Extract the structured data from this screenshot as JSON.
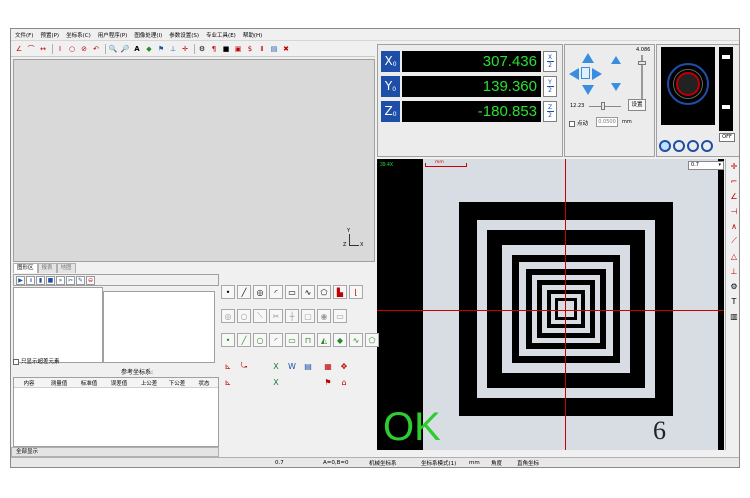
{
  "menu": [
    "文件(F)",
    "预置(P)",
    "坐标系(C)",
    "用户程序(P)",
    "图像处理(I)",
    "参数设置(S)",
    "专业工具(E)",
    "帮助(H)"
  ],
  "toolbar_icons": [
    "angle-tool-icon",
    "polyline-tool-icon",
    "width-tool-icon",
    "height-tool-icon",
    "circle-tool-icon",
    "no-entry-icon",
    "arc-tool-icon",
    "zoom-in-icon",
    "zoom-out-icon",
    "text-tool-icon",
    "color-fill-icon",
    "flag-icon",
    "coordinate-icon",
    "crosshair-icon",
    "gear-icon",
    "probe-icon",
    "stop-icon",
    "program-icon",
    "save-icon",
    "tolerance-icon",
    "report-icon",
    "delete-icon"
  ],
  "canvas": {
    "axis_y": "Y",
    "axis_x": "X",
    "axis_z": "Z"
  },
  "dro": [
    {
      "axis": "X",
      "sub": "0",
      "value": "307.436",
      "half_top": "X",
      "half_bot": "2"
    },
    {
      "axis": "Y",
      "sub": "0",
      "value": "139.360",
      "half_top": "Y",
      "half_bot": "2"
    },
    {
      "axis": "Z",
      "sub": "0",
      "value": "-180.853",
      "half_top": "Z",
      "half_bot": "2"
    }
  ],
  "motion": {
    "speed_top": "4.086",
    "speed_value": "12.23",
    "set_button": "设置",
    "point_label": "点动",
    "step_value": "0.0500",
    "step_unit": "mm"
  },
  "lens": {
    "off_label": "OFF"
  },
  "camera": {
    "zoom": "39.4X",
    "scale_label": "mm",
    "result": "OK",
    "mark": "6",
    "dropdown_value": "0.7"
  },
  "tabs": [
    "图形区",
    "报表",
    "地图"
  ],
  "list": {
    "checkbox_label": "只显示超差元素"
  },
  "reference": {
    "label": "参考坐标系:"
  },
  "table": {
    "headers": [
      "内容",
      "测量值",
      "标准值",
      "误差值",
      "上公差",
      "下公差",
      "状态"
    ]
  },
  "show_all": "全部显示",
  "status": {
    "s1": "0.7",
    "s2": "A=0,B=0",
    "s3": "机械坐标系",
    "s4": "坐标系模式(1)",
    "s5": "mm",
    "s6": "角度",
    "s7": "直角坐标"
  },
  "colors": {
    "accent": "#1e4fa8",
    "dro_green": "#29e030",
    "ok_green": "#2ecc2e",
    "cross_red": "#cc0000"
  }
}
